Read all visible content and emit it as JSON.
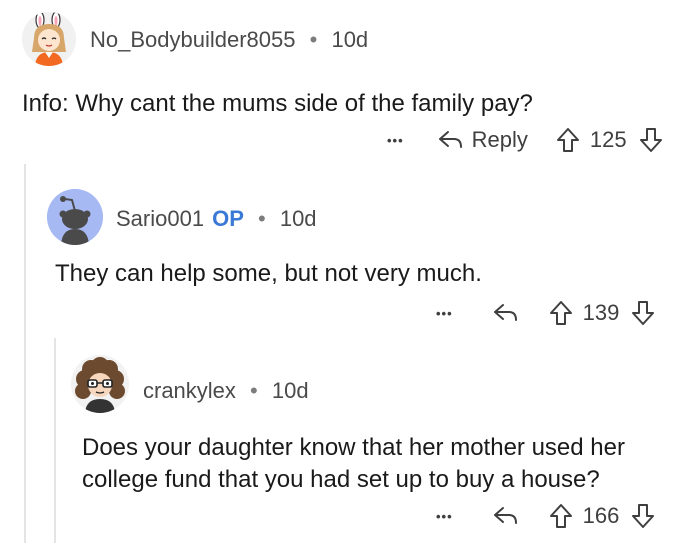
{
  "comments": [
    {
      "username": "No_Bodybuilder8055",
      "separator": "•",
      "time": "10d",
      "body": "Info: Why cant the mums side of the family pay?",
      "more": "•••",
      "reply_label": "Reply",
      "score": "125",
      "avatar_icon": "avatar-bunny-girl-icon"
    },
    {
      "username": "Sario001",
      "op_badge": "OP",
      "separator": "•",
      "time": "10d",
      "body": "They can help some, but not very much.",
      "more": "•••",
      "score": "139",
      "avatar_icon": "avatar-default-snoo-icon"
    },
    {
      "username": "crankylex",
      "separator": "•",
      "time": "10d",
      "body_line1": "Does your daughter know that her mother used her",
      "body_line2": "college fund that you had set up to buy a house?",
      "more": "•••",
      "score": "166",
      "avatar_icon": "avatar-curly-hair-icon"
    }
  ],
  "colors": {
    "text": "#1a1a1b",
    "meta": "#4a4a4a",
    "op_badge": "#3a79d6",
    "thread_line": "#e4e4e4",
    "snoo_avatar_bg": "#a7b9f3"
  }
}
